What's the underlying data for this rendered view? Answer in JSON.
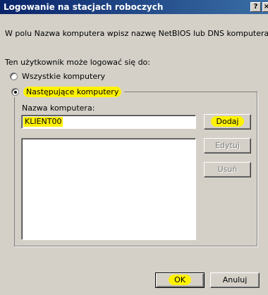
{
  "window": {
    "title": "Logowanie na stacjach roboczych",
    "help_glyph": "?",
    "close_glyph": "×"
  },
  "instruction": "W polu Nazwa komputera wpisz nazwę NetBIOS lub DNS komputera.",
  "logon_to_label": "Ten użytkownik może logować się do:",
  "options": {
    "all_computers": "Wszystkie komputery",
    "following_computers": "Następujące komputery",
    "selected": "following_computers"
  },
  "computer_name": {
    "label": "Nazwa komputera:",
    "value": "KLIENT00"
  },
  "buttons": {
    "add": "Dodaj",
    "edit": "Edytuj",
    "remove": "Usuń",
    "ok": "OK",
    "cancel": "Anuluj"
  },
  "colors": {
    "highlight": "#fff200",
    "titlebar": "#0a246a",
    "dialog_bg": "#d4d0c8"
  }
}
